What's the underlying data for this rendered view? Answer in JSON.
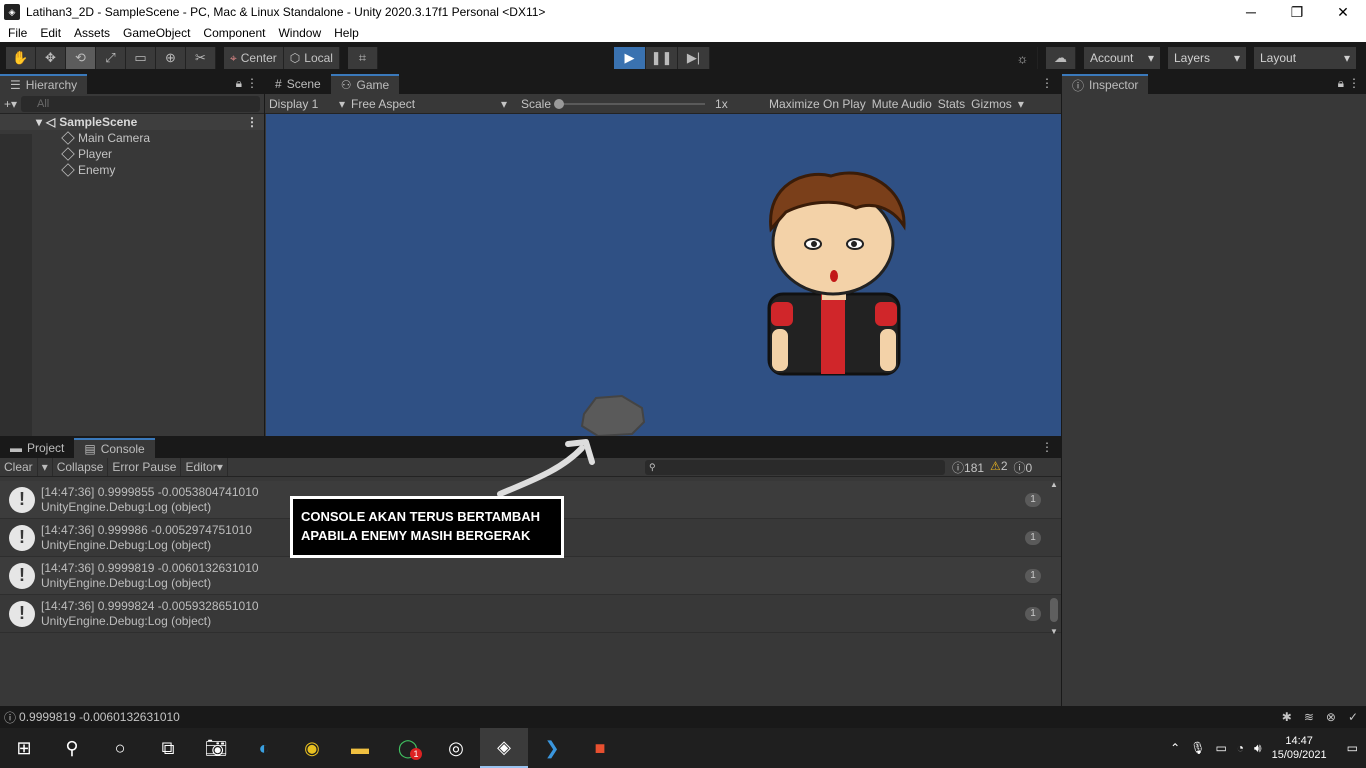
{
  "window": {
    "title": "Latihan3_2D - SampleScene - PC, Mac & Linux Standalone - Unity 2020.3.17f1 Personal <DX11>",
    "minimize": "─",
    "maximize": "❐",
    "close": "✕"
  },
  "menu": [
    "File",
    "Edit",
    "Assets",
    "GameObject",
    "Component",
    "Window",
    "Help"
  ],
  "toolbar": {
    "pivot": "Center",
    "space": "Local",
    "account": "Account",
    "layers": "Layers",
    "layout": "Layout"
  },
  "hierarchy": {
    "tab": "Hierarchy",
    "search_placeholder": "All",
    "scene": "SampleScene",
    "items": [
      "Main Camera",
      "Player",
      "Enemy"
    ]
  },
  "game_view": {
    "tab_scene": "Scene",
    "tab_game": "Game",
    "display": "Display 1",
    "aspect": "Free Aspect",
    "scale_label": "Scale",
    "scale_value": "1x",
    "maximize": "Maximize On Play",
    "mute": "Mute Audio",
    "stats": "Stats",
    "gizmos": "Gizmos",
    "background": "#2f5084"
  },
  "inspector": {
    "tab": "Inspector"
  },
  "console": {
    "tab_project": "Project",
    "tab_console": "Console",
    "clear": "Clear",
    "collapse": "Collapse",
    "error_pause": "Error Pause",
    "editor": "Editor",
    "count_log": "181",
    "count_warn": "2",
    "count_error": "0",
    "logs": [
      {
        "line1": "[14:47:36] 0.9999855 -0.0053804741010",
        "line2": "UnityEngine.Debug:Log (object)",
        "count": "1"
      },
      {
        "line1": "[14:47:36] 0.999986 -0.0052974751010",
        "line2": "UnityEngine.Debug:Log (object)",
        "count": "1"
      },
      {
        "line1": "[14:47:36] 0.9999819 -0.0060132631010",
        "line2": "UnityEngine.Debug:Log (object)",
        "count": "1"
      },
      {
        "line1": "[14:47:36] 0.9999824 -0.0059328651010",
        "line2": "UnityEngine.Debug:Log (object)",
        "count": "1"
      }
    ]
  },
  "annotation": {
    "line1": "CONSOLE AKAN TERUS BERTAMBAH",
    "line2": "APABILA ENEMY MASIH BERGERAK"
  },
  "status": {
    "text": "0.9999819 -0.0060132631010"
  },
  "taskbar": {
    "time": "14:47",
    "date": "15/09/2021",
    "whatsapp_badge": "1"
  }
}
